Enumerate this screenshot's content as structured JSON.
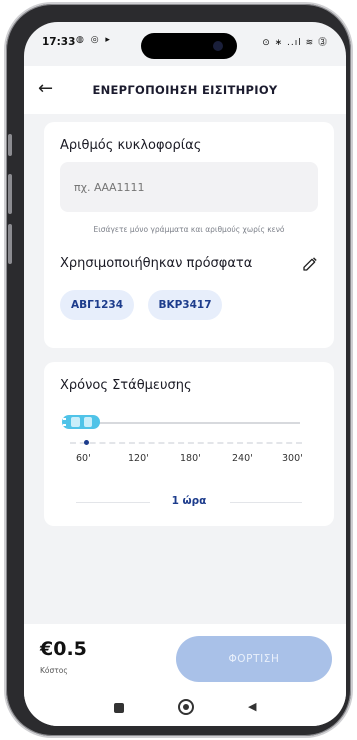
{
  "status_bar": {
    "time": "17:33",
    "left_icons": "◍ ◎ ▸",
    "right_icons": "⊙ ∗ ..ıl ≋ ⓷"
  },
  "header": {
    "back_icon": "back-arrow-icon",
    "title": "ΕΝΕΡΓΟΠΟΙΗΣΗ ΕΙΣΙΤΗΡΙΟΥ"
  },
  "plate": {
    "label": "Αριθμός κυκλοφορίας",
    "placeholder": "πχ. ΑΑΑ1111",
    "value": "",
    "hint": "Εισάγετε μόνο γράμματα και αριθμούς χωρίς κενό"
  },
  "recent": {
    "label": "Χρησιμοποιήθηκαν πρόσφατα",
    "edit_icon": "pencil-icon",
    "plates": [
      "ΑΒΓ1234",
      "ΒΚΡ3417"
    ]
  },
  "parking_time": {
    "label": "Χρόνος Στάθμευσης",
    "ticks": [
      "60'",
      "120'",
      "180'",
      "240'",
      "300'"
    ],
    "selected": "1 ώρα",
    "slider_position": 0
  },
  "footer": {
    "price": "€0.5",
    "price_label": "Κόστος",
    "charge_button": "ΦΟΡΤΙΣΗ"
  },
  "colors": {
    "primary": "#1d3c8c",
    "button_disabled": "#a9c1e8",
    "chip_bg": "#e7eefb",
    "car": "#4fc3e8"
  }
}
